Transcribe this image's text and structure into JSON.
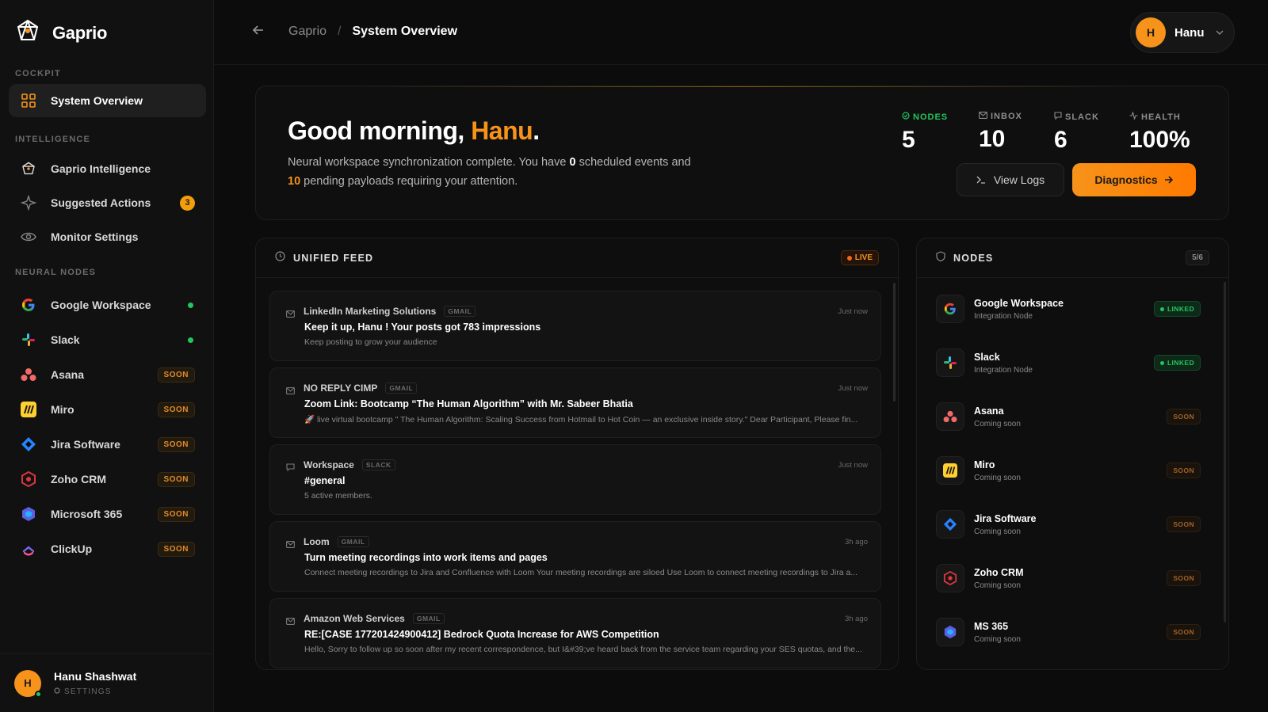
{
  "app": {
    "name": "Gaprio"
  },
  "sidebar": {
    "sections": {
      "cockpit": "COCKPIT",
      "intelligence": "INTELLIGENCE",
      "neural_nodes": "NEURAL NODES"
    },
    "cockpit_items": [
      {
        "label": "System Overview"
      }
    ],
    "intelligence_items": [
      {
        "label": "Gaprio Intelligence"
      },
      {
        "label": "Suggested Actions",
        "badge": "3"
      },
      {
        "label": "Monitor Settings"
      }
    ],
    "node_items": [
      {
        "label": "Google Workspace",
        "status": "connected"
      },
      {
        "label": "Slack",
        "status": "connected"
      },
      {
        "label": "Asana",
        "badge": "SOON"
      },
      {
        "label": "Miro",
        "badge": "SOON"
      },
      {
        "label": "Jira Software",
        "badge": "SOON"
      },
      {
        "label": "Zoho CRM",
        "badge": "SOON"
      },
      {
        "label": "Microsoft 365",
        "badge": "SOON"
      },
      {
        "label": "ClickUp",
        "badge": "SOON"
      }
    ],
    "user": {
      "initial": "H",
      "name": "Hanu Shashwat",
      "settings_label": "SETTINGS"
    }
  },
  "topbar": {
    "breadcrumb_root": "Gaprio",
    "breadcrumb_sep": "/",
    "breadcrumb_current": "System Overview",
    "user_initial": "H",
    "user_name": "Hanu"
  },
  "hero": {
    "greeting_prefix": "Good morning, ",
    "greeting_name": "Hanu",
    "greeting_suffix": ".",
    "sub_1": "Neural workspace synchronization complete. You have ",
    "sub_events": "0",
    "sub_2": " scheduled events and ",
    "sub_payloads": "10",
    "sub_3": " pending payloads requiring your attention.",
    "stats": [
      {
        "label": "NODES",
        "value": "5"
      },
      {
        "label": "INBOX",
        "value": "10"
      },
      {
        "label": "SLACK",
        "value": "6"
      },
      {
        "label": "HEALTH",
        "value": "100%"
      }
    ],
    "view_logs_label": "View Logs",
    "diagnostics_label": "Diagnostics"
  },
  "feed": {
    "title": "UNIFIED FEED",
    "live_label": "LIVE",
    "items": [
      {
        "sender": "LinkedIn Marketing Solutions",
        "tag": "GMAIL",
        "time": "Just now",
        "subject": "Keep it up, Hanu ! Your posts got 783 impressions",
        "preview": "Keep posting to grow your audience"
      },
      {
        "sender": "NO REPLY CIMP",
        "tag": "GMAIL",
        "time": "Just now",
        "subject": "Zoom Link: Bootcamp “The Human Algorithm” with Mr. Sabeer Bhatia",
        "preview": "🚀 live virtual bootcamp \" The Human Algorithm: Scaling Success from Hotmail to Hot Coin — an exclusive inside story.\" Dear Participant, Please fin..."
      },
      {
        "sender": "Workspace",
        "tag": "SLACK",
        "time": "Just now",
        "subject": "#general",
        "preview": "5 active members."
      },
      {
        "sender": "Loom",
        "tag": "GMAIL",
        "time": "3h ago",
        "subject": "Turn meeting recordings into work items and pages",
        "preview": "Connect meeting recordings to Jira and Confluence with Loom Your meeting recordings are siloed Use Loom to connect meeting recordings to Jira a..."
      },
      {
        "sender": "Amazon Web Services",
        "tag": "GMAIL",
        "time": "3h ago",
        "subject": "RE:[CASE 177201424900412] Bedrock Quota Increase for AWS Competition",
        "preview": "Hello, Sorry to follow up so soon after my recent correspondence, but I&#39;ve heard back from the service team regarding your SES quotas, and the..."
      }
    ]
  },
  "nodes": {
    "title": "NODES",
    "count": "5/6",
    "items": [
      {
        "name": "Google Workspace",
        "sub": "Integration Node",
        "status": "LINKED"
      },
      {
        "name": "Slack",
        "sub": "Integration Node",
        "status": "LINKED"
      },
      {
        "name": "Asana",
        "sub": "Coming soon",
        "status": "SOON"
      },
      {
        "name": "Miro",
        "sub": "Coming soon",
        "status": "SOON"
      },
      {
        "name": "Jira Software",
        "sub": "Coming soon",
        "status": "SOON"
      },
      {
        "name": "Zoho CRM",
        "sub": "Coming soon",
        "status": "SOON"
      },
      {
        "name": "MS 365",
        "sub": "Coming soon",
        "status": "SOON"
      }
    ]
  },
  "colors": {
    "accent": "#f7931a",
    "success": "#22c55e",
    "background": "#0c0c0c"
  }
}
